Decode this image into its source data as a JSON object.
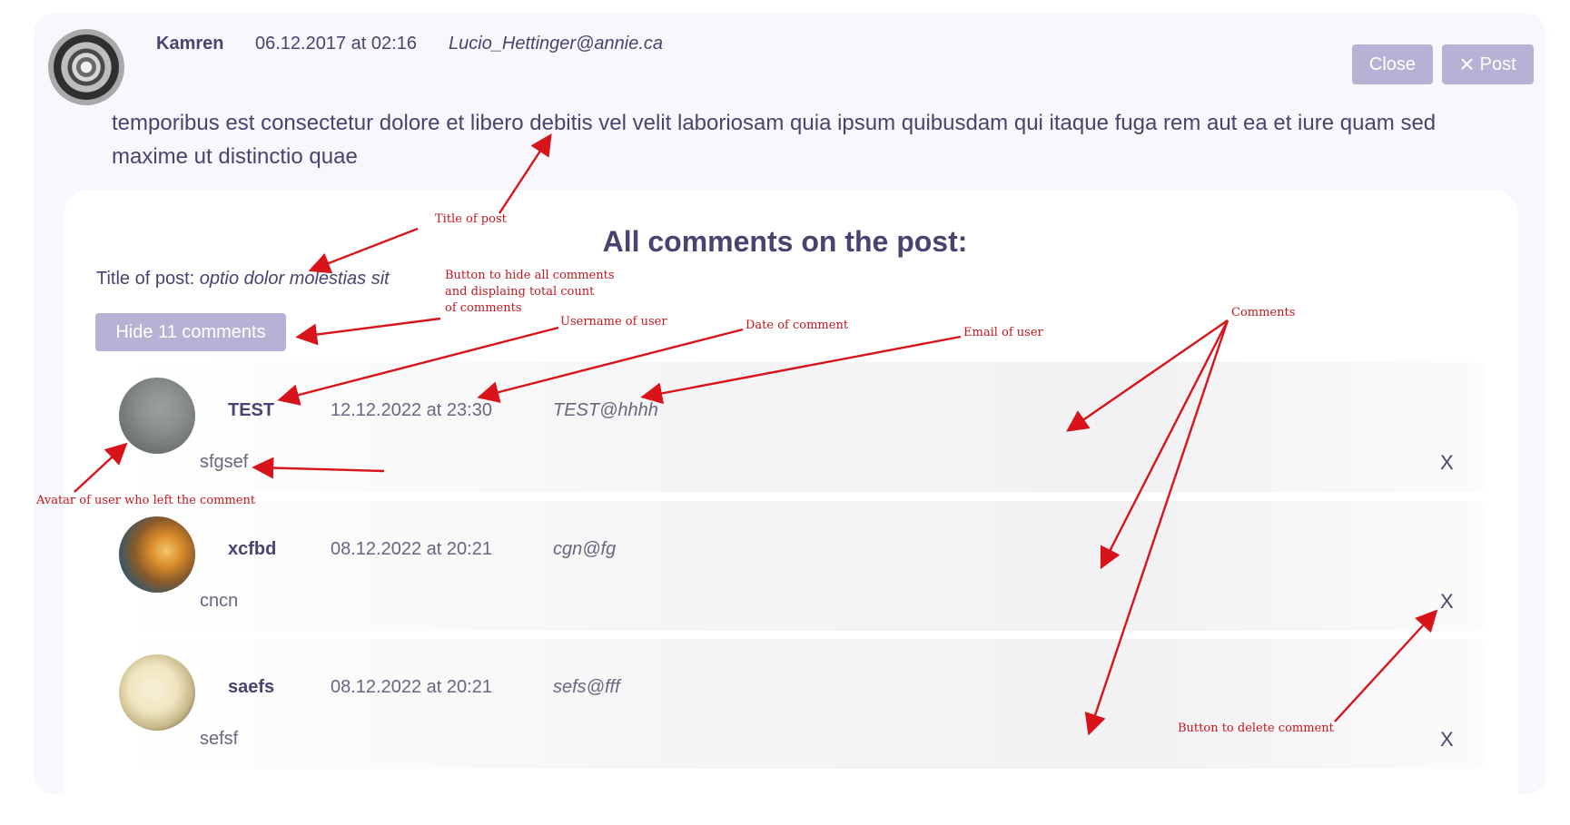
{
  "post": {
    "author": "Kamren",
    "date": "06.12.2017 at 02:16",
    "email": "Lucio_Hettinger@annie.ca",
    "body": "temporibus est consectetur dolore et libero debitis vel velit laboriosam quia ipsum quibusdam qui itaque fuga rem aut ea et iure quam sed maxime ut distinctio quae",
    "close_label": "Close",
    "post_label": "Post",
    "post_icon": "×"
  },
  "comments_section": {
    "heading": "All comments on the post:",
    "title_prefix": "Title of post: ",
    "title_value": "optio dolor molestias sit",
    "hide_button": "Hide 11 comments"
  },
  "comments": [
    {
      "username": "TEST",
      "date": "12.12.2022 at 23:30",
      "email": "TEST@hhhh",
      "text": "sfgsef",
      "delete": "X"
    },
    {
      "username": "xcfbd",
      "date": "08.12.2022 at 20:21",
      "email": "cgn@fg",
      "text": "cncn",
      "delete": "X"
    },
    {
      "username": "saefs",
      "date": "08.12.2022 at 20:21",
      "email": "sefs@fff",
      "text": "sefsf",
      "delete": "X"
    }
  ],
  "annotations": {
    "title_of_post": "Title of post",
    "hide_button": "Button to hide all comments\nand displaing total count\nof comments",
    "username": "Username of user",
    "date": "Date of comment",
    "email": "Email of user",
    "comments": "Comments",
    "avatar": "Avatar of user who left the comment",
    "delete": "Button to delete comment"
  },
  "colors": {
    "text": "#4a4270",
    "button": "#b7b2d5",
    "annotation": "#c4161c"
  }
}
